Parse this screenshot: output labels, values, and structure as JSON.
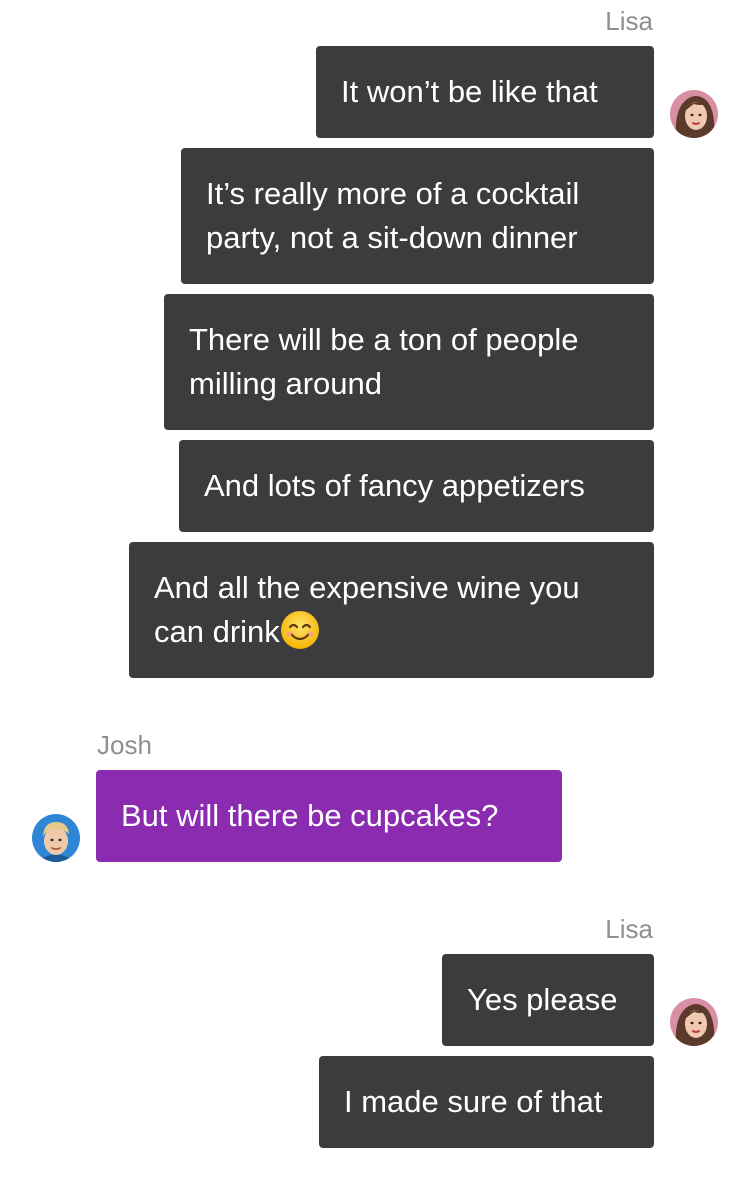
{
  "thread": {
    "group1": {
      "sender": "Lisa",
      "messages": [
        {
          "line1": "It won’t be like that"
        },
        {
          "line1": "It’s really more of a cocktail",
          "line2": "party, not a sit-down dinner"
        },
        {
          "line1": "There will be a ton of people",
          "line2": "milling around"
        },
        {
          "line1": "And lots of fancy appetizers"
        },
        {
          "line1": "And all the expensive wine you",
          "line2": "can drink",
          "emoji": "smiling-face-emoji"
        }
      ],
      "avatar": "lisa-avatar"
    },
    "group2": {
      "sender": "Josh",
      "messages": [
        {
          "line1": "But will there be cupcakes?"
        }
      ],
      "avatar": "josh-avatar"
    },
    "group3": {
      "sender": "Lisa",
      "messages": [
        {
          "line1": "Yes please"
        },
        {
          "line1": "I made sure of that"
        }
      ],
      "avatar": "lisa-avatar"
    }
  },
  "colors": {
    "outgoing_bubble": "#3c3c3e",
    "incoming_bubble": "#8a2bb0",
    "sender_label": "#8e8e93",
    "background": "#ffffff"
  }
}
